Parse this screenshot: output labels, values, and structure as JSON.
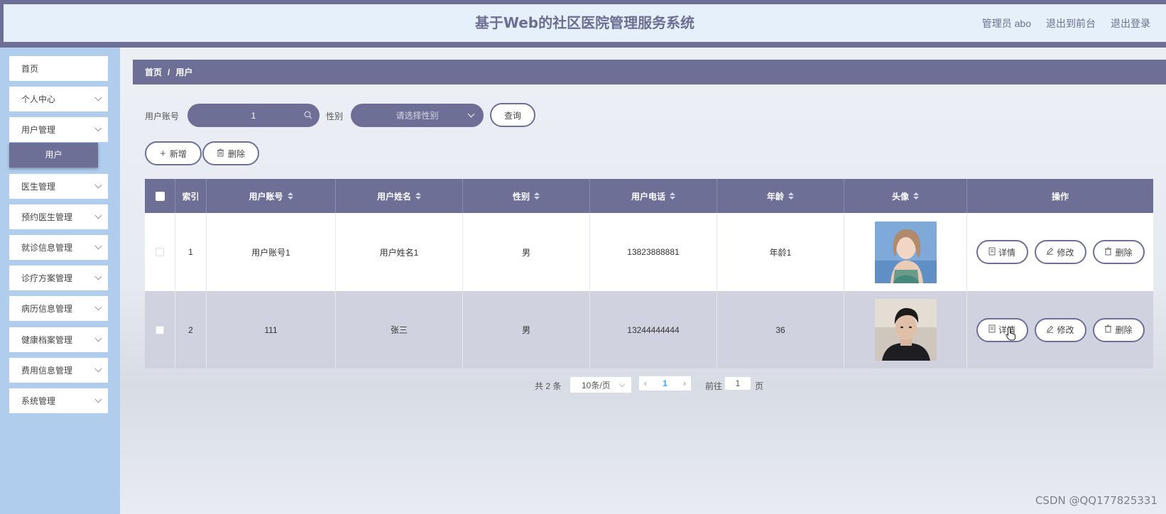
{
  "header": {
    "title": "基于Web的社区医院管理服务系统",
    "admin_label": "管理员 abo",
    "to_front": "退出到前台",
    "logout": "退出登录"
  },
  "sidebar": {
    "items": [
      {
        "label": "首页",
        "has_arrow": false
      },
      {
        "label": "个人中心",
        "has_arrow": true
      },
      {
        "label": "用户管理",
        "has_arrow": true
      },
      {
        "label": "医生管理",
        "has_arrow": true
      },
      {
        "label": "预约医生管理",
        "has_arrow": true
      },
      {
        "label": "就诊信息管理",
        "has_arrow": true
      },
      {
        "label": "诊疗方案管理",
        "has_arrow": true
      },
      {
        "label": "病历信息管理",
        "has_arrow": true
      },
      {
        "label": "健康档案管理",
        "has_arrow": true
      },
      {
        "label": "费用信息管理",
        "has_arrow": true
      },
      {
        "label": "系统管理",
        "has_arrow": true
      }
    ],
    "active_sub": "用户"
  },
  "breadcrumb": {
    "home": "首页",
    "sep": "/",
    "current": "用户"
  },
  "search": {
    "account_label": "用户账号",
    "account_value": "1",
    "gender_label": "性别",
    "gender_placeholder": "请选择性别",
    "query_button": "查询"
  },
  "actions": {
    "add": "新增",
    "delete": "删除"
  },
  "table": {
    "columns": [
      "索引",
      "用户账号",
      "用户姓名",
      "性别",
      "用户电话",
      "年龄",
      "头像",
      "操作"
    ],
    "rows": [
      {
        "index": "1",
        "account": "用户账号1",
        "name": "用户姓名1",
        "gender": "男",
        "phone": "13823888881",
        "age": "年龄1"
      },
      {
        "index": "2",
        "account": "111",
        "name": "张三",
        "gender": "男",
        "phone": "13244444444",
        "age": "36"
      }
    ],
    "row_buttons": {
      "detail": "详情",
      "edit": "修改",
      "delete": "删除"
    }
  },
  "pagination": {
    "total": "共 2 条",
    "page_size": "10条/页",
    "current_page": "1",
    "goto_label": "前往",
    "goto_value": "1",
    "page_suffix": "页"
  },
  "watermark": "CSDN @QQ177825331",
  "colors": {
    "accent": "#6e6f97",
    "sidebar": "#b1cdee",
    "header_bg": "#e6f0fa"
  }
}
